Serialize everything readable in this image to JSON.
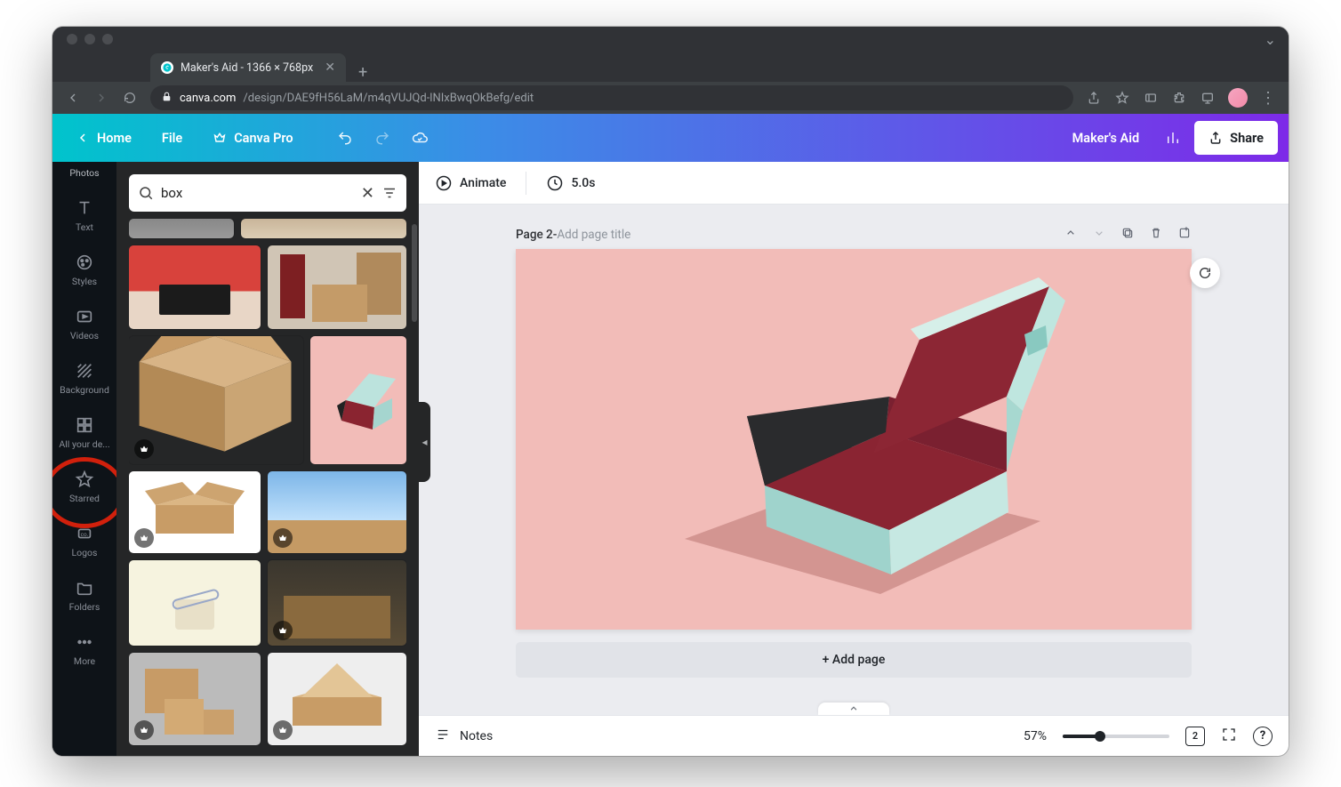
{
  "browser": {
    "tab_title": "Maker's Aid - 1366 × 768px",
    "url_host": "canva.com",
    "url_path": "/design/DAE9fH56LaM/m4qVUJQd-lNIxBwqOkBefg/edit"
  },
  "header": {
    "home": "Home",
    "file": "File",
    "pro": "Canva Pro",
    "project_name": "Maker's Aid",
    "share": "Share"
  },
  "rail": {
    "photos": "Photos",
    "text": "Text",
    "styles": "Styles",
    "videos": "Videos",
    "background": "Background",
    "all_designs": "All your de...",
    "starred": "Starred",
    "logos": "Logos",
    "folders": "Folders",
    "more": "More"
  },
  "search": {
    "value": "box"
  },
  "canvas_topbar": {
    "animate": "Animate",
    "duration": "5.0s"
  },
  "page": {
    "label": "Page 2",
    "separator": " - ",
    "title_hint": "Add page title",
    "add_page": "+ Add page"
  },
  "footer": {
    "notes": "Notes",
    "zoom": "57%",
    "page_count": "2",
    "help": "?"
  }
}
